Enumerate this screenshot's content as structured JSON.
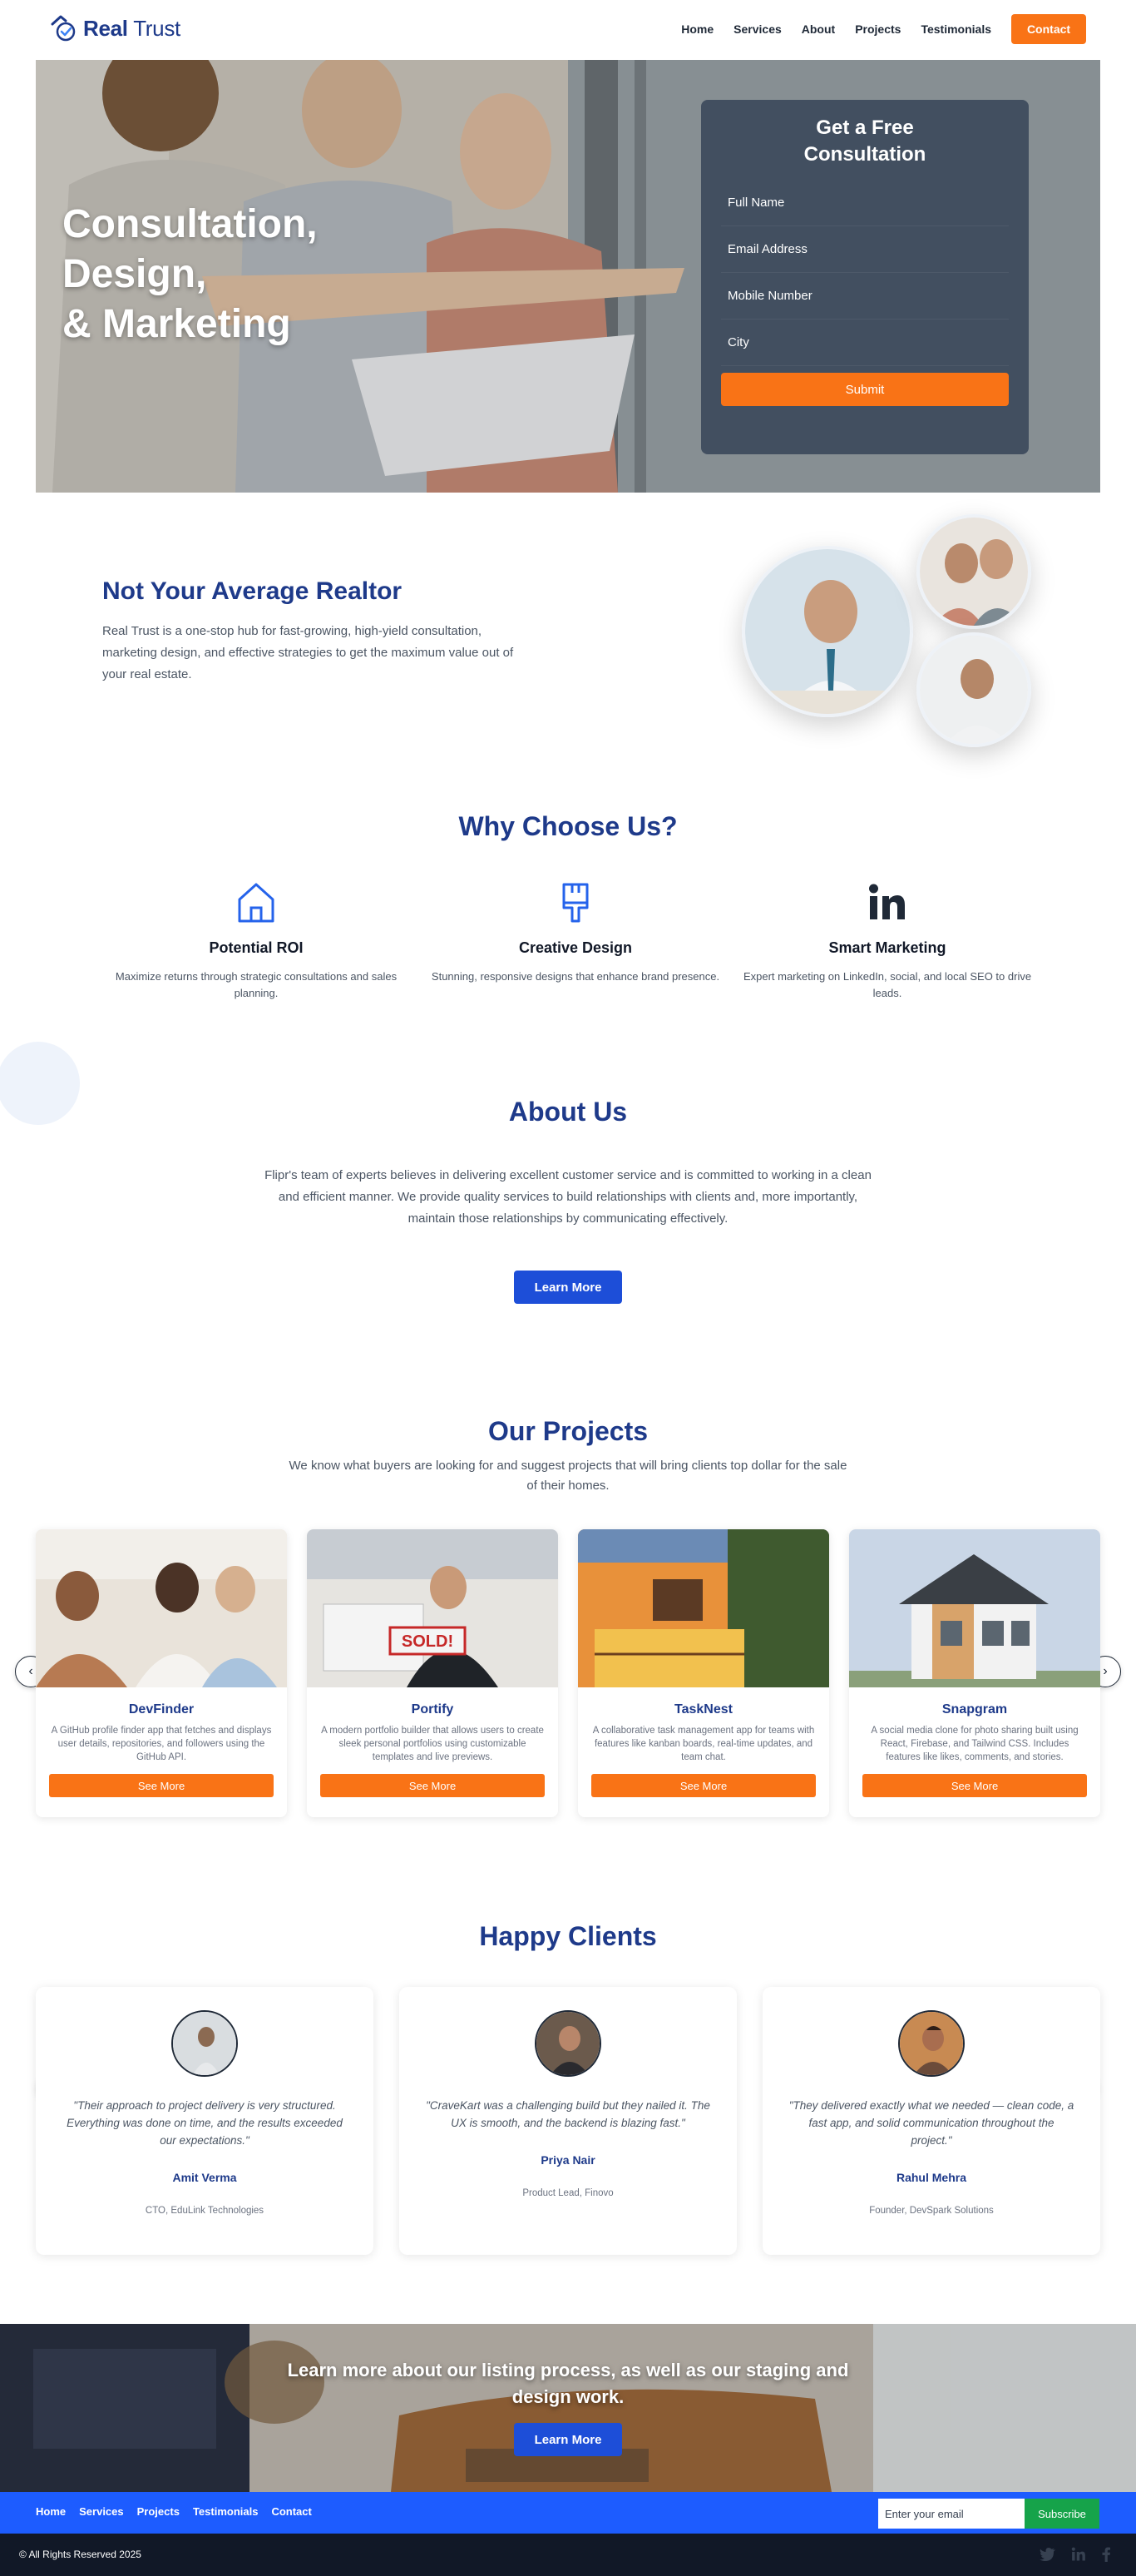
{
  "brand": {
    "name_bold": "Real",
    "name_rest": " Trust"
  },
  "nav": {
    "links": [
      "Home",
      "Services",
      "About",
      "Projects",
      "Testimonials"
    ],
    "contact": "Contact"
  },
  "hero": {
    "title_lines": [
      "Consultation,",
      "Design,",
      "& Marketing"
    ],
    "form": {
      "title": "Get a Free Consultation",
      "fields": [
        "Full Name",
        "Email Address",
        "Mobile Number",
        "City"
      ],
      "submit": "Submit"
    }
  },
  "realtor": {
    "title": "Not Your Average Realtor",
    "text": "Real Trust is a one-stop hub for fast-growing, high-yield consultation, marketing design, and effective strategies to get the maximum value out of your real estate."
  },
  "why": {
    "title": "Why Choose Us?",
    "features": [
      {
        "icon": "home-icon",
        "title": "Potential ROI",
        "text": "Maximize returns through strategic consultations and sales planning."
      },
      {
        "icon": "paintbrush-icon",
        "title": "Creative Design",
        "text": "Stunning, responsive designs that enhance brand presence."
      },
      {
        "icon": "linkedin-icon",
        "title": "Smart Marketing",
        "text": "Expert marketing on LinkedIn, social, and local SEO to drive leads."
      }
    ]
  },
  "about": {
    "title": "About Us",
    "text": "Flipr's team of experts believes in delivering excellent customer service and is committed to working in a clean and efficient manner. We provide quality services to build relationships with clients and, more importantly, maintain those relationships by communicating effectively.",
    "button": "Learn More"
  },
  "projects": {
    "title": "Our Projects",
    "subtitle": "We know what buyers are looking for and suggest projects that will bring clients top dollar for the sale of their homes.",
    "items": [
      {
        "name": "DevFinder",
        "desc": "A GitHub profile finder app that fetches and displays user details, repositories, and followers using the GitHub API.",
        "button": "See More"
      },
      {
        "name": "Portify",
        "desc": "A modern portfolio builder that allows users to create sleek personal portfolios using customizable templates and live previews.",
        "button": "See More"
      },
      {
        "name": "TaskNest",
        "desc": "A collaborative task management app for teams with features like kanban boards, real-time updates, and team chat.",
        "button": "See More"
      },
      {
        "name": "Snapgram",
        "desc": "A social media clone for photo sharing built using React, Firebase, and Tailwind CSS. Includes features like likes, comments, and stories.",
        "button": "See More"
      }
    ],
    "sold_sign": "SOLD!"
  },
  "clients": {
    "title": "Happy Clients",
    "items": [
      {
        "quote": "\"Their approach to project delivery is very structured. Everything was done on time, and the results exceeded our expectations.\"",
        "name": "Amit Verma",
        "role": "CTO, EduLink Technologies"
      },
      {
        "quote": "\"CraveKart was a challenging build but they nailed it. The UX is smooth, and the backend is blazing fast.\"",
        "name": "Priya Nair",
        "role": "Product Lead, Finovo"
      },
      {
        "quote": "\"They delivered exactly what we needed — clean code, a fast app, and solid communication throughout the project.\"",
        "name": "Rahul Mehra",
        "role": "Founder, DevSpark Solutions"
      }
    ]
  },
  "cta": {
    "text": "Learn more about our listing process, as well as our staging and design work.",
    "button": "Learn More"
  },
  "footer": {
    "links": [
      "Home",
      "Services",
      "Projects",
      "Testimonials",
      "Contact"
    ],
    "email_placeholder": "Enter your email",
    "subscribe": "Subscribe",
    "copyright": "© All Rights Reserved 2025",
    "social_icons": [
      "twitter-icon",
      "linkedin-icon",
      "facebook-icon"
    ]
  },
  "colors": {
    "primary": "#1e3a8a",
    "accent_orange": "#f97316",
    "button_blue": "#1d4ed8",
    "footer_blue": "#1d5cff",
    "subscribe_green": "#16a34a"
  }
}
